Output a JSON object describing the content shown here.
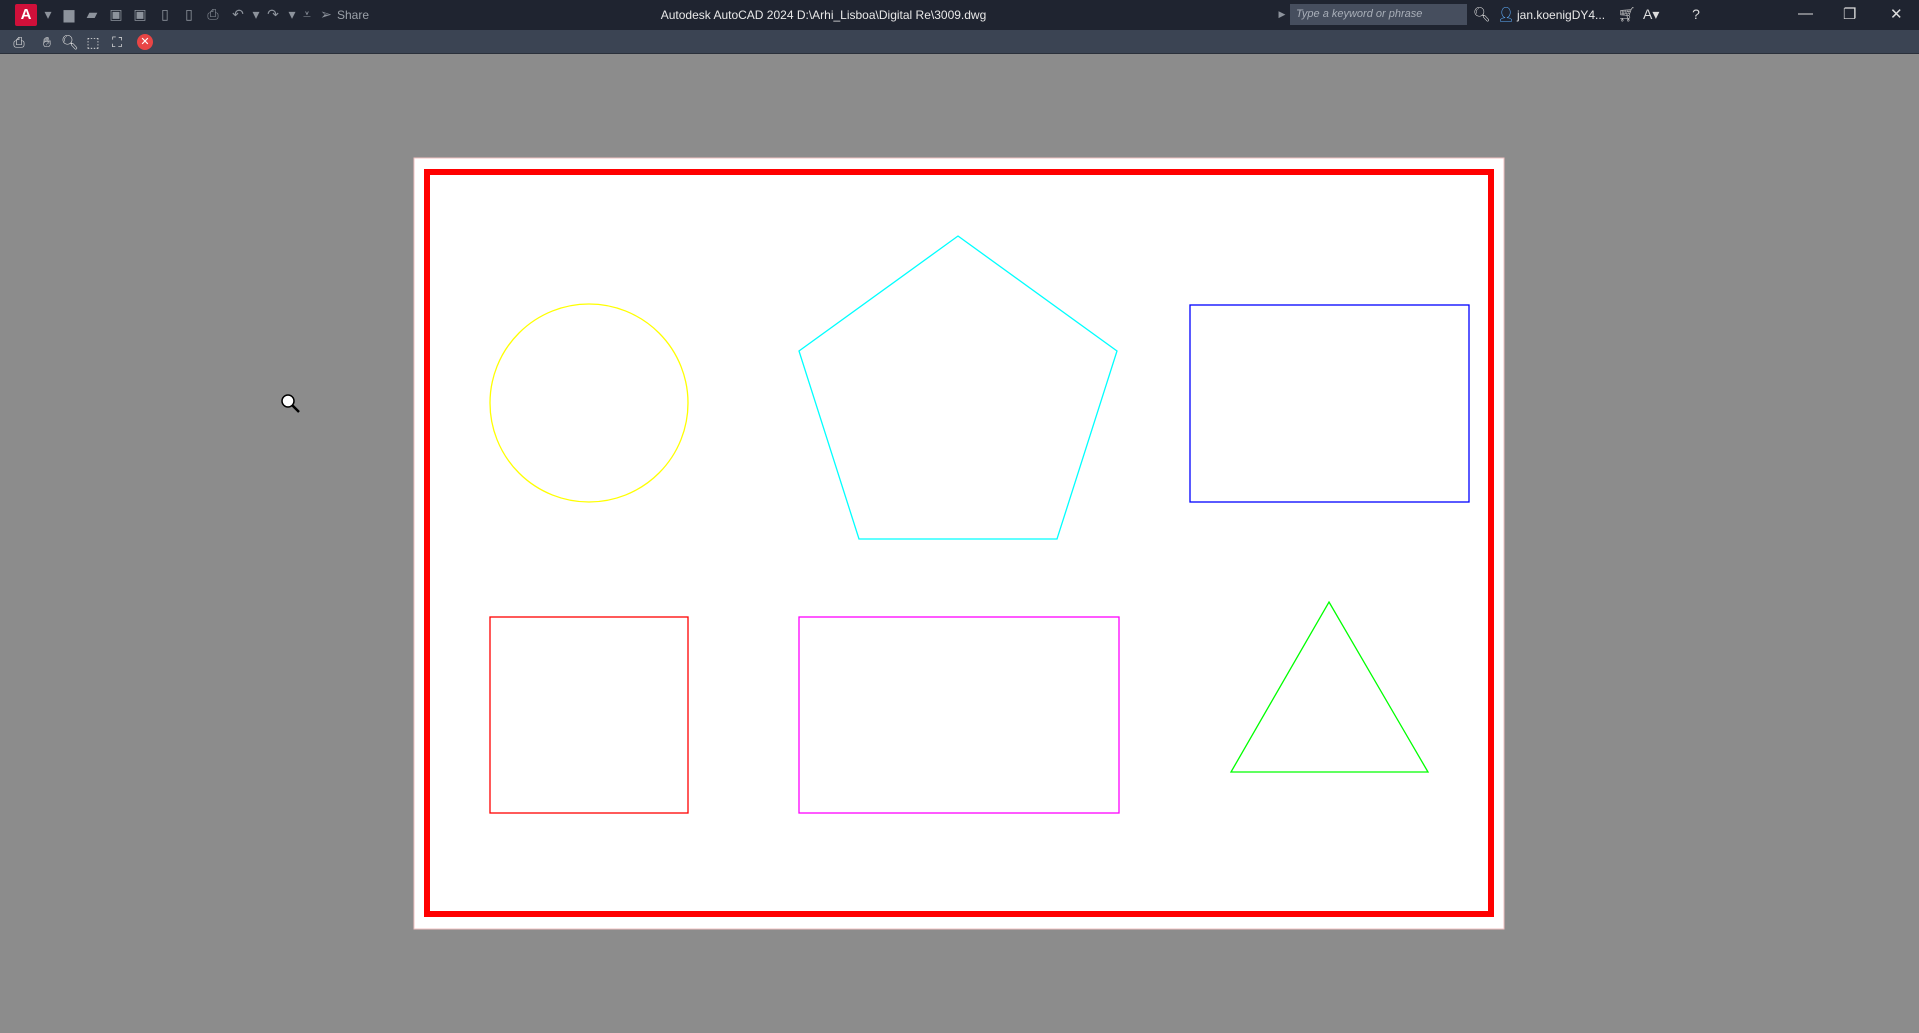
{
  "app": {
    "logo_letter": "A",
    "title": "Autodesk AutoCAD 2024    D:\\Arhi_Lisboa\\Digital Re\\3009.dwg",
    "share_label": "Share"
  },
  "search": {
    "placeholder": "Type a keyword or phrase"
  },
  "user": {
    "name": "jan.koenigDY4..."
  },
  "colors": {
    "circle": "#ffff00",
    "pentagon": "#00ffff",
    "rect_blue": "#0000ff",
    "square_red": "#ff0000",
    "rect_magenta": "#ff00ff",
    "triangle": "#00ff00",
    "border": "#ff0000"
  }
}
